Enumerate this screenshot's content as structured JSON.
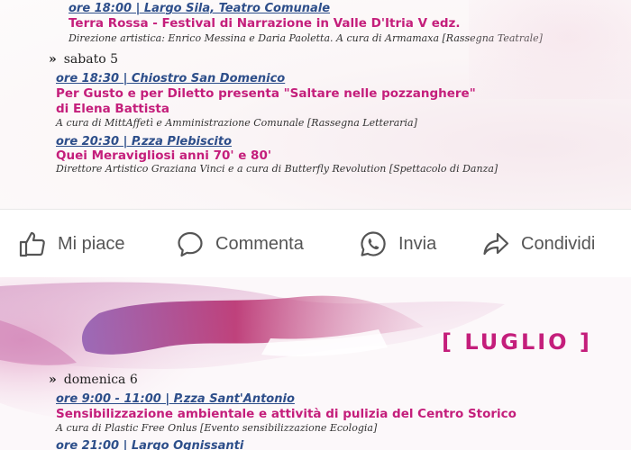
{
  "top_flyer": {
    "event_0": {
      "time_venue": "ore 18:00 | Largo Sila, Teatro Comunale",
      "title": "Terra Rossa - Festival di Narrazione in Valle D'Itria V edz.",
      "credit": "Direzione artistica: Enrico Messina e Daria Paoletta. A cura di Armamaxa [Rassegna Teatrale]"
    },
    "day": {
      "chevron": "»",
      "label": "sabato 5"
    },
    "event_1": {
      "time_venue": "ore 18:30 | Chiostro San Domenico",
      "title_line1": "Per Gusto e per Diletto presenta \"Saltare nelle pozzanghere\"",
      "title_line2": "di Elena Battista",
      "credit": "A cura di MittAffetì e Amministrazione Comunale [Rassegna Letteraria]"
    },
    "event_2": {
      "time_venue": "ore 20:30 | P.zza Plebiscito",
      "title": "Quei Meravigliosi anni 70' e 80'",
      "credit": "Direttore Artistico Graziana Vinci e a cura di Butterfly Revolution [Spettacolo di Danza]"
    }
  },
  "actions": {
    "like": {
      "label": "Mi piace",
      "icon": "thumbs-up-icon"
    },
    "comment": {
      "label": "Commenta",
      "icon": "speech-bubble-icon"
    },
    "send": {
      "label": "Invia",
      "icon": "whatsapp-icon"
    },
    "share": {
      "label": "Condividi",
      "icon": "share-arrow-icon"
    }
  },
  "bottom_flyer": {
    "month": "[ LUGLIO ]",
    "day": {
      "chevron": "»",
      "label": "domenica 6"
    },
    "event_0": {
      "time_venue": "ore 9:00 - 11:00 | P.zza Sant'Antonio",
      "title": "Sensibilizzazione ambientale e attività di pulizia del Centro Storico",
      "credit": "A cura di Plastic Free Onlus [Evento sensibilizzazione Ecologia]"
    },
    "event_1": {
      "time_venue": "ore 21:00 | Largo Ognissanti"
    }
  },
  "colors": {
    "title_magenta": "#c41e7b",
    "time_blue": "#2d4e8a",
    "action_gray": "#555555"
  }
}
